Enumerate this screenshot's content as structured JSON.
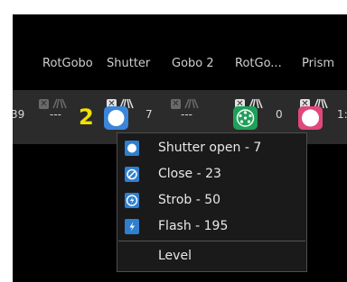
{
  "header": {
    "columns": [
      "RotGobo",
      "Shutter",
      "Gobo 2",
      "RotGo...",
      "Prism"
    ]
  },
  "row": {
    "left_value": "39",
    "gobo1_value": "---",
    "shutter_value": "7",
    "gobo2_value": "---",
    "rotgobo_value": "0",
    "prism_value": "1:",
    "marker": "2",
    "marker_color": "#f2e200",
    "shutter_color": "#3a86d8",
    "rotgobo_color": "#1fa05a",
    "prism_color": "#e0487a"
  },
  "menu": {
    "items": [
      {
        "label": "Shutter open - 7",
        "icon": "circle-open-icon"
      },
      {
        "label": "Close - 23",
        "icon": "circle-slash-icon"
      },
      {
        "label": "Strob - 50",
        "icon": "strobe-bolt-icon"
      },
      {
        "label": "Flash - 195",
        "icon": "flash-bolt-icon"
      }
    ],
    "level_label": "Level",
    "accent_color": "#2f7fd0"
  }
}
